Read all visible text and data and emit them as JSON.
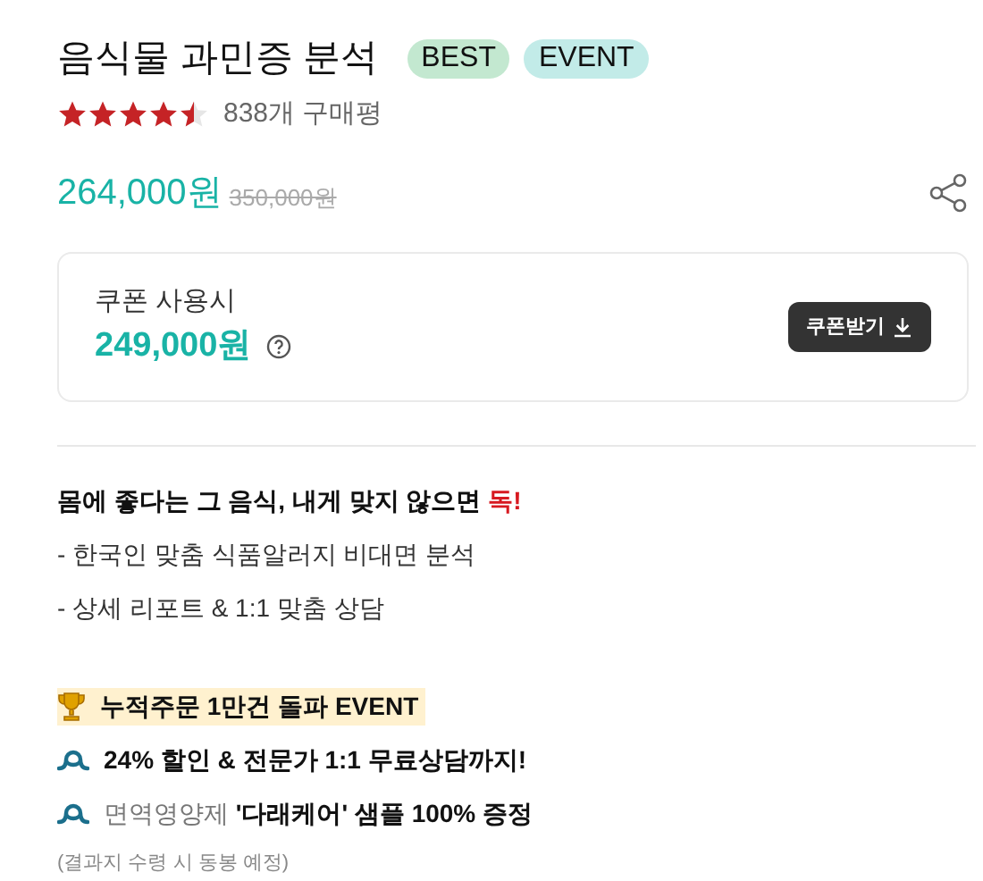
{
  "product": {
    "title": "음식물 과민증 분석",
    "badges": [
      {
        "label": "BEST",
        "color": "#c3e8d0"
      },
      {
        "label": "EVENT",
        "color": "#c2ebe8"
      }
    ],
    "stars": 4.5,
    "review_count": "838개 구매평",
    "price": "264,000원",
    "original_price": "350,000원"
  },
  "coupon": {
    "label": "쿠폰 사용시",
    "price": "249,000원",
    "button": "쿠폰받기"
  },
  "description": {
    "headline": "몸에 좋다는 그 음식, 내게 맞지 않으면 ",
    "headline_accent": "독!",
    "bullets": [
      "- 한국인 맞춤 식품알러지 비대면 분석",
      "- 상세 리포트 & 1:1 맞춤 상담"
    ]
  },
  "event": {
    "title": "누적주문 1만건 돌파 EVENT",
    "lines": [
      "**24% 할인 & 전문가 1:1 무료상담까지!**",
      "면역영양제 **'다래케어' 샘플 100% 증정**"
    ],
    "note": "(결과지 수령 시 동봉 예정)"
  }
}
